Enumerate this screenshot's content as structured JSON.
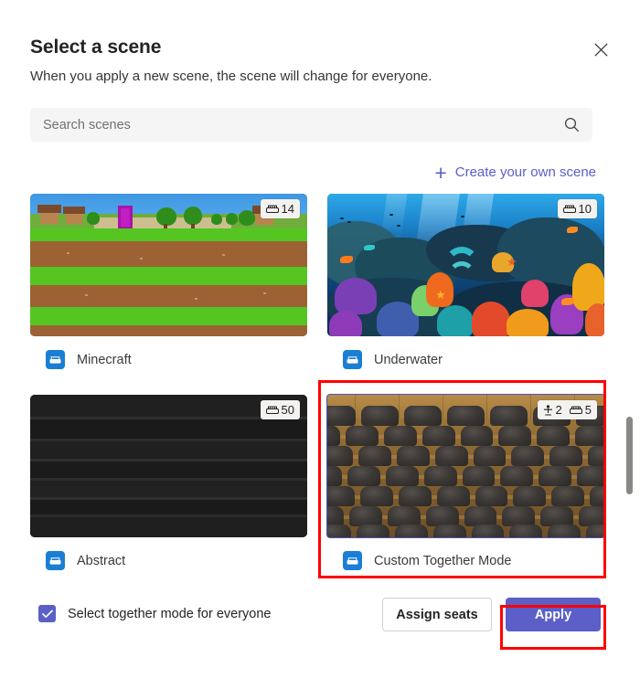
{
  "dialog": {
    "title": "Select a scene",
    "subtitle": "When you apply a new scene, the scene will change for everyone.",
    "close_label": "Close"
  },
  "search": {
    "value": "",
    "placeholder": "Search scenes",
    "icon": "search-icon"
  },
  "create_scene": {
    "label": "Create your own scene",
    "icon": "plus-icon",
    "color": "#5b5fc7"
  },
  "scenes": [
    {
      "name": "Minecraft",
      "icon": "together-mode-seat-icon",
      "selected": false,
      "badge": {
        "seats": "14",
        "seat_icon": "seat-icon",
        "people": "",
        "people_icon": ""
      }
    },
    {
      "name": "Underwater",
      "icon": "together-mode-seat-icon",
      "selected": false,
      "badge": {
        "seats": "10",
        "seat_icon": "seat-icon",
        "people": "",
        "people_icon": ""
      }
    },
    {
      "name": "Abstract",
      "icon": "together-mode-seat-icon",
      "selected": false,
      "badge": {
        "seats": "50",
        "seat_icon": "seat-icon",
        "people": "",
        "people_icon": ""
      }
    },
    {
      "name": "Custom Together Mode",
      "icon": "together-mode-seat-icon",
      "selected": true,
      "badge": {
        "seats": "5",
        "seat_icon": "seat-icon",
        "people": "2",
        "people_icon": "person-standing-icon"
      }
    }
  ],
  "footer": {
    "checkbox_label": "Select together mode for everyone",
    "checkbox_checked": true,
    "assign_seats_label": "Assign seats",
    "apply_label": "Apply"
  },
  "colors": {
    "accent": "#5b5fc7",
    "selection_border": "#4b53bc",
    "annotation": "#ff0000",
    "scene_icon": "#1a7fd4",
    "search_bg": "#f5f5f5"
  },
  "scrollbar": {
    "orientation": "vertical",
    "position": "middle"
  }
}
